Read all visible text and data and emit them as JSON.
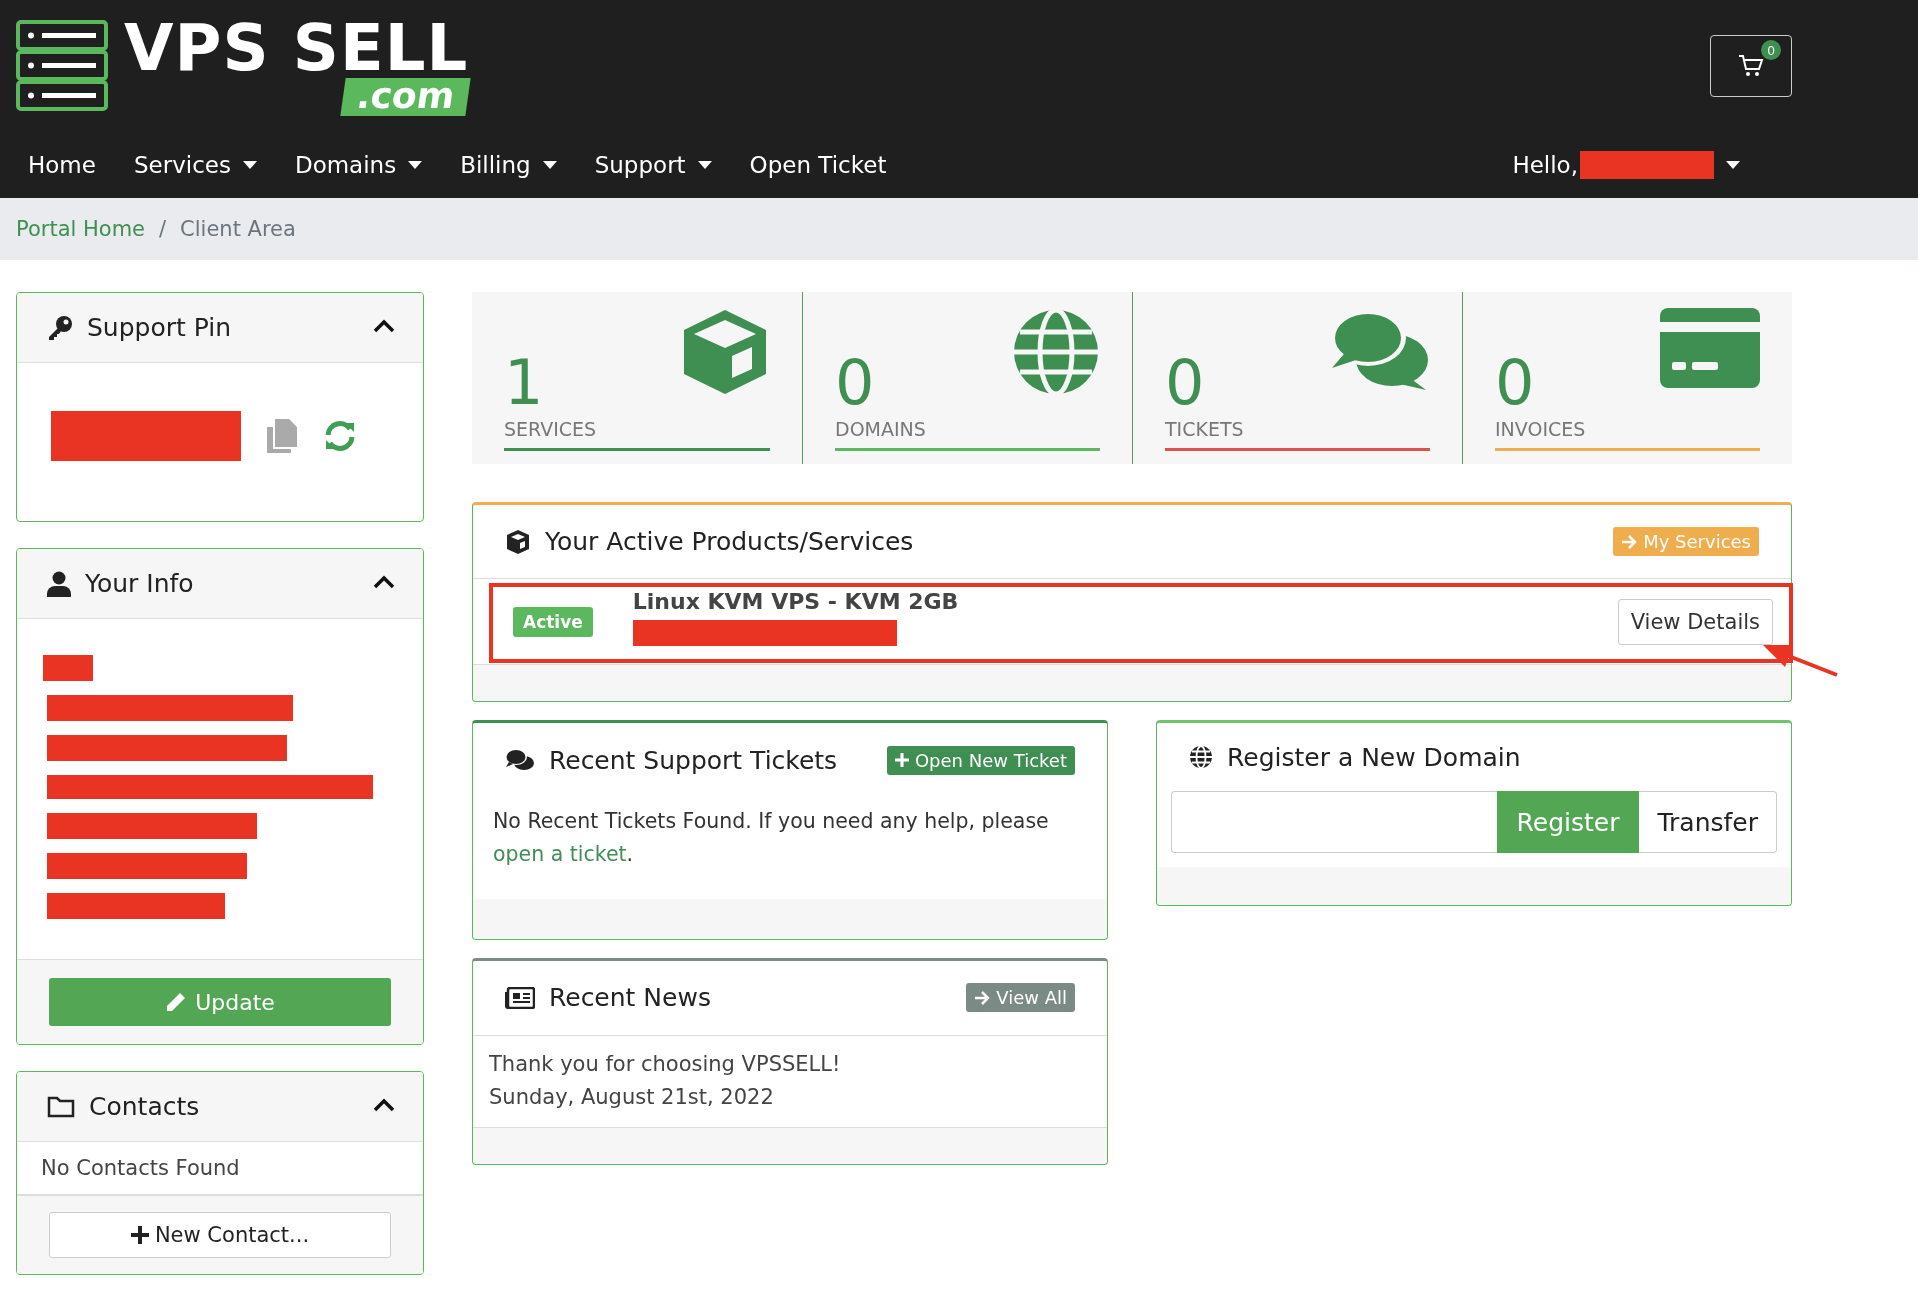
{
  "logo": {
    "text": "VPS SELL",
    "suffix": ".com"
  },
  "cart": {
    "count": "0"
  },
  "nav": [
    {
      "label": "Home",
      "dropdown": false
    },
    {
      "label": "Services",
      "dropdown": true
    },
    {
      "label": "Domains",
      "dropdown": true
    },
    {
      "label": "Billing",
      "dropdown": true
    },
    {
      "label": "Support",
      "dropdown": true
    },
    {
      "label": "Open Ticket",
      "dropdown": false
    }
  ],
  "user_menu": {
    "greeting": "Hello,",
    "dropdown": true
  },
  "breadcrumb_separator": "/",
  "breadcrumb": [
    {
      "label": "Portal Home",
      "link": true
    },
    {
      "label": "Client Area",
      "link": false
    }
  ],
  "sidebar": {
    "support_pin": {
      "title": "Support Pin",
      "expanded": true
    },
    "your_info": {
      "title": "Your Info",
      "expanded": true,
      "button": "Update"
    },
    "contacts": {
      "title": "Contacts",
      "expanded": true,
      "empty": "No Contacts Found",
      "button": "New Contact..."
    }
  },
  "stats": [
    {
      "kind": "box",
      "number": "1",
      "label": "SERVICES",
      "color": "#3f8f53"
    },
    {
      "kind": "globe",
      "number": "0",
      "label": "DOMAINS",
      "color": "#5cb85c"
    },
    {
      "kind": "chat",
      "number": "0",
      "label": "TICKETS",
      "color": "#d9534f"
    },
    {
      "kind": "card",
      "number": "0",
      "label": "INVOICES",
      "color": "#f0ad4e"
    }
  ],
  "products": {
    "title": "Your Active Products/Services",
    "button": "My Services",
    "items": [
      {
        "status": "Active",
        "name": "Linux KVM VPS - KVM 2GB",
        "button": "View Details"
      }
    ]
  },
  "tickets": {
    "title": "Recent Support Tickets",
    "button": "Open New Ticket",
    "message": "No Recent Tickets Found. If you need any help, please",
    "link": "open a ticket",
    "after": "."
  },
  "domain": {
    "title": "Register a New Domain",
    "register": "Register",
    "transfer": "Transfer"
  },
  "news": {
    "title": "Recent News",
    "button": "View All",
    "items": [
      {
        "title": "Thank you for choosing VPSSELL!",
        "date": "Sunday, August 21st, 2022"
      }
    ]
  }
}
